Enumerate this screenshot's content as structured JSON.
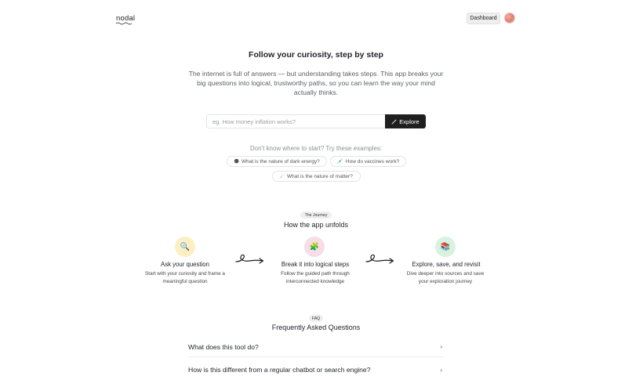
{
  "header": {
    "logo": "nodal",
    "dashboard_label": "Dashboard"
  },
  "hero": {
    "title": "Follow your curiosity, step by step",
    "subtitle": "The internet is full of answers — but understanding takes steps. This app breaks your big questions into logical, trustworthy paths, so you can learn the way your mind actually thinks."
  },
  "search": {
    "placeholder": "eg. How money inflation works?",
    "value": "",
    "button_label": "Explore",
    "button_icon": "magic-wand-icon"
  },
  "examples": {
    "label": "Don't know where to start? Try these examples:",
    "items": [
      {
        "icon": "dark-planet-icon",
        "glyph": "🌑",
        "label": "What is the nature of dark energy?"
      },
      {
        "icon": "syringe-icon",
        "glyph": "💉",
        "label": "How do vaccines work?"
      },
      {
        "icon": "comet-icon",
        "glyph": "☄",
        "label": "What is the nature of matter?"
      }
    ]
  },
  "journey": {
    "pill": "The Journey",
    "title": "How the app unfolds",
    "steps": [
      {
        "icon": "magnifier-icon",
        "glyph": "🔍",
        "title": "Ask your question",
        "desc": "Start with your curiosity and frame a meaningful question"
      },
      {
        "icon": "puzzle-icon",
        "glyph": "🧩",
        "title": "Break it into logical steps",
        "desc": "Follow the guided path through interconnected knowledge"
      },
      {
        "icon": "books-icon",
        "glyph": "📚",
        "title": "Explore, save, and revisit",
        "desc": "Dive deeper into sources and save your exploration journey"
      }
    ]
  },
  "faq": {
    "pill": "FAQ",
    "title": "Frequently Asked Questions",
    "items": [
      {
        "question": "What does this tool do?",
        "chevron": "›"
      },
      {
        "question": "How is this different from a regular chatbot or search engine?",
        "chevron": "›"
      }
    ]
  },
  "colors": {
    "explore_button": "#1f1f1f",
    "step1_bg": "#fbefc3",
    "step2_bg": "#f7dde6",
    "step3_bg": "#d9f2e0"
  }
}
